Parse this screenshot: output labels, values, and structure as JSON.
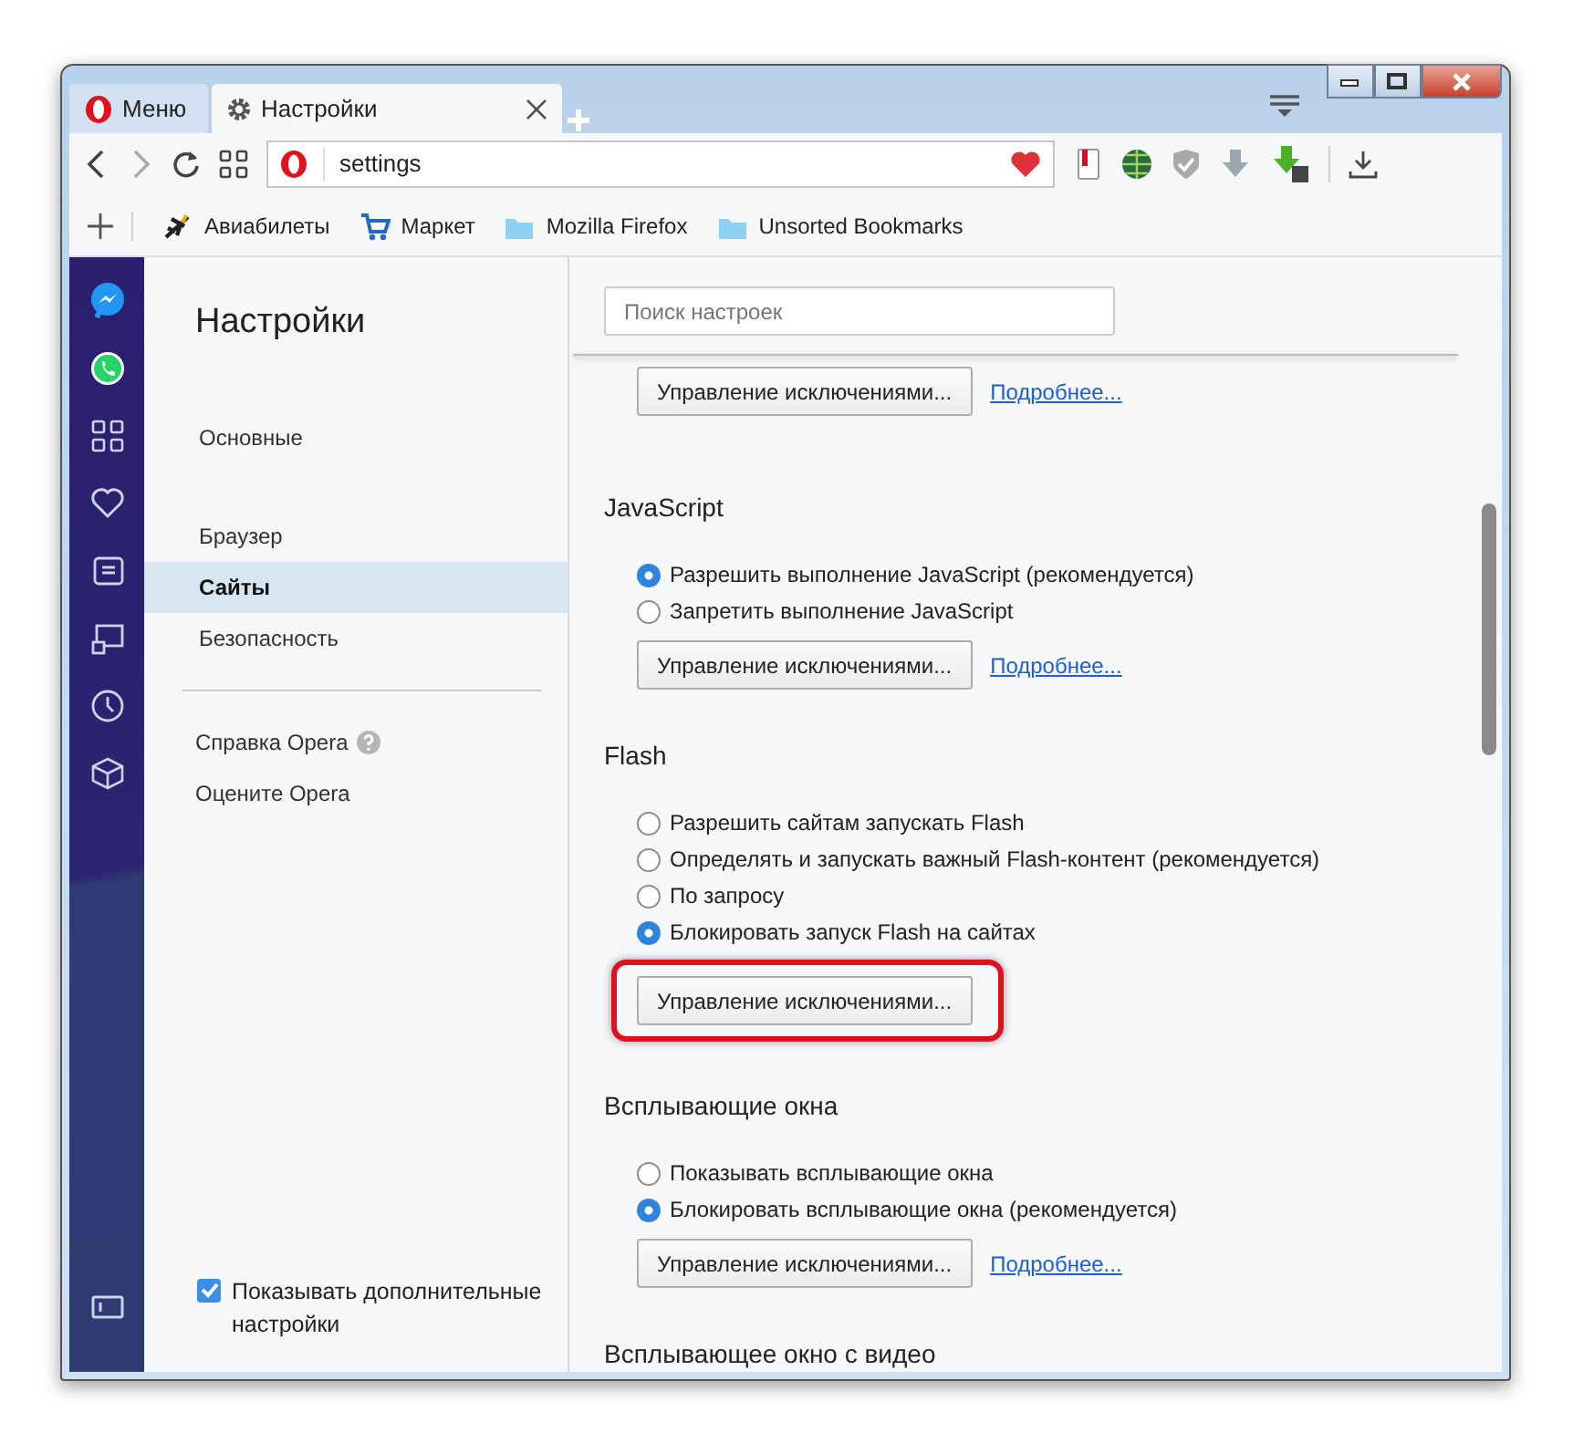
{
  "menu_button": {
    "label": "Меню"
  },
  "tabs": [
    {
      "label": "Настройки",
      "selected": true
    }
  ],
  "address_bar": {
    "value": "settings"
  },
  "bookmarks": [
    {
      "label": "Авиабилеты",
      "kind": "plane"
    },
    {
      "label": "Маркет",
      "kind": "cart"
    },
    {
      "label": "Mozilla Firefox",
      "kind": "folder"
    },
    {
      "label": "Unsorted Bookmarks",
      "kind": "folder"
    }
  ],
  "sidebar": {
    "items": [
      {
        "kind": "messenger"
      },
      {
        "kind": "whatsapp"
      },
      {
        "kind": "speed-dial"
      },
      {
        "kind": "heart"
      },
      {
        "kind": "news"
      },
      {
        "kind": "screen"
      },
      {
        "kind": "clock"
      },
      {
        "kind": "cube"
      },
      {
        "kind": "panel"
      }
    ]
  },
  "nav": {
    "title": "Настройки",
    "groups": [
      [
        {
          "label": "Основные",
          "selected": false
        }
      ],
      [
        {
          "label": "Браузер",
          "selected": false
        },
        {
          "label": "Сайты",
          "selected": true
        },
        {
          "label": "Безопасность",
          "selected": false
        }
      ]
    ],
    "links": [
      {
        "label": "Справка Opera",
        "help": true
      },
      {
        "label": "Оцените Opera",
        "help": false
      }
    ],
    "show_advanced": {
      "label": "Показывать дополнительные настройки",
      "checked": true
    }
  },
  "search": {
    "placeholder": "Поиск настроек"
  },
  "sections": [
    {
      "exceptions_button": "Управление исключениями...",
      "more_link": "Подробнее...",
      "highlighted": false
    },
    {
      "title": "JavaScript",
      "options": [
        {
          "label": "Разрешить выполнение JavaScript (рекомендуется)",
          "selected": true
        },
        {
          "label": "Запретить выполнение JavaScript",
          "selected": false
        }
      ],
      "exceptions_button": "Управление исключениями...",
      "more_link": "Подробнее...",
      "highlighted": false
    },
    {
      "title": "Flash",
      "options": [
        {
          "label": "Разрешить сайтам запускать Flash",
          "selected": false
        },
        {
          "label": "Определять и запускать важный Flash-контент (рекомендуется)",
          "selected": false
        },
        {
          "label": "По запросу",
          "selected": false
        },
        {
          "label": "Блокировать запуск Flash на сайтах",
          "selected": true
        }
      ],
      "exceptions_button": "Управление исключениями...",
      "highlighted": true
    },
    {
      "title": "Всплывающие окна",
      "options": [
        {
          "label": "Показывать всплывающие окна",
          "selected": false
        },
        {
          "label": "Блокировать всплывающие окна (рекомендуется)",
          "selected": true
        }
      ],
      "exceptions_button": "Управление исключениями...",
      "more_link": "Подробнее...",
      "highlighted": false
    },
    {
      "title": "Всплывающее окно с видео"
    }
  ]
}
